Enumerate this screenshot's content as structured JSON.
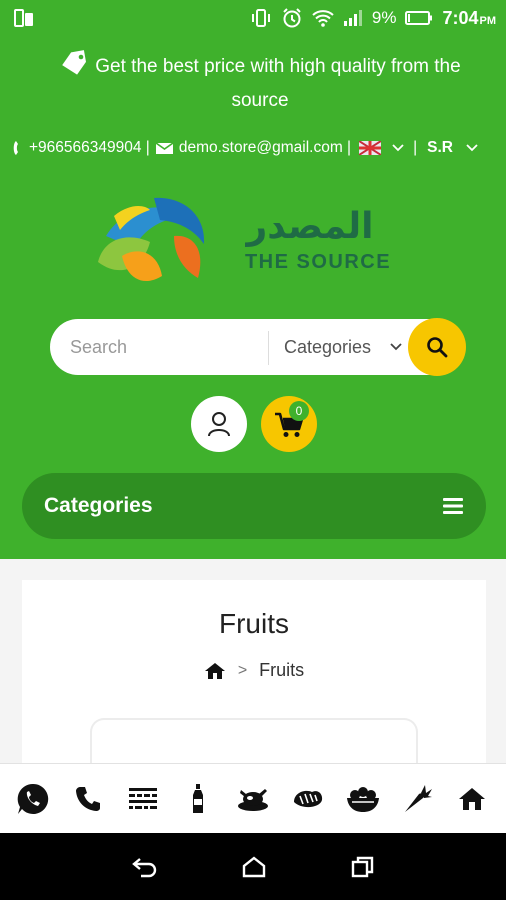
{
  "status_bar": {
    "battery": "9%",
    "time": "7:04",
    "ampm": "PM"
  },
  "promo": {
    "text": "Get the best price with high quality from the source"
  },
  "contact": {
    "phone": "+966566349904 |",
    "email": "demo.store@gmail.com |",
    "currency": "S.R",
    "separator": "|"
  },
  "logo": {
    "arabic": "المصدر",
    "english": "THE SOURCE"
  },
  "search": {
    "placeholder": "Search",
    "categories_label": "Categories"
  },
  "cart": {
    "count": "0"
  },
  "category_bar": {
    "label": "Categories"
  },
  "page": {
    "title": "Fruits",
    "breadcrumb_current": "Fruits",
    "breadcrumb_separator": ">"
  },
  "bottom_bar": {
    "icons": [
      "whatsapp-icon",
      "phone-icon",
      "barcode-icon",
      "bottle-icon",
      "roast-chicken-icon",
      "bread-icon",
      "vegetable-basket-icon",
      "carrot-icon",
      "home-icon"
    ]
  },
  "colors": {
    "brand_green": "#3fb12c",
    "dark_green": "#2f8f22",
    "accent_yellow": "#f7c600"
  }
}
